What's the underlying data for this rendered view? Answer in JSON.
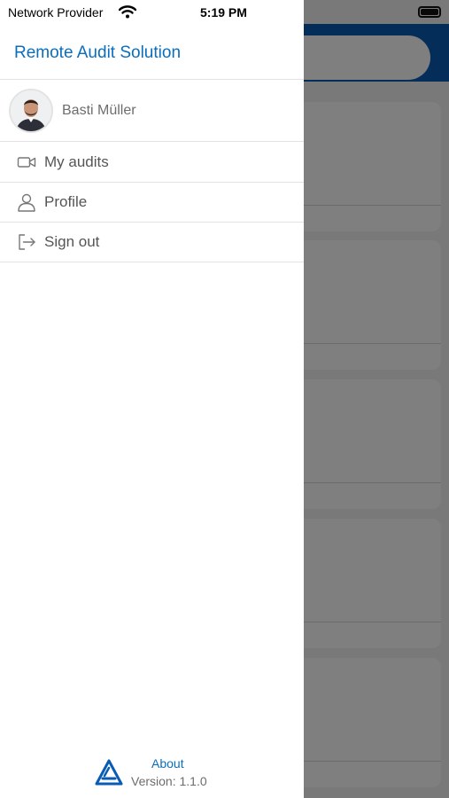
{
  "status_bar": {
    "carrier": "Network Provider",
    "time": "5:19 PM"
  },
  "drawer": {
    "title": "Remote Audit Solution",
    "user": {
      "name": "Basti Müller"
    },
    "menu": [
      {
        "label": "My audits",
        "icon": "video-camera-icon"
      },
      {
        "label": "Profile",
        "icon": "user-icon"
      },
      {
        "label": "Sign out",
        "icon": "sign-out-icon"
      }
    ],
    "footer": {
      "about_label": "About",
      "version": "Version: 1.1.0"
    }
  },
  "colors": {
    "accent": "#0a6ebd",
    "header_underlay": "#0a5bb4",
    "overlay": "rgba(0,0,0,0.5)"
  }
}
